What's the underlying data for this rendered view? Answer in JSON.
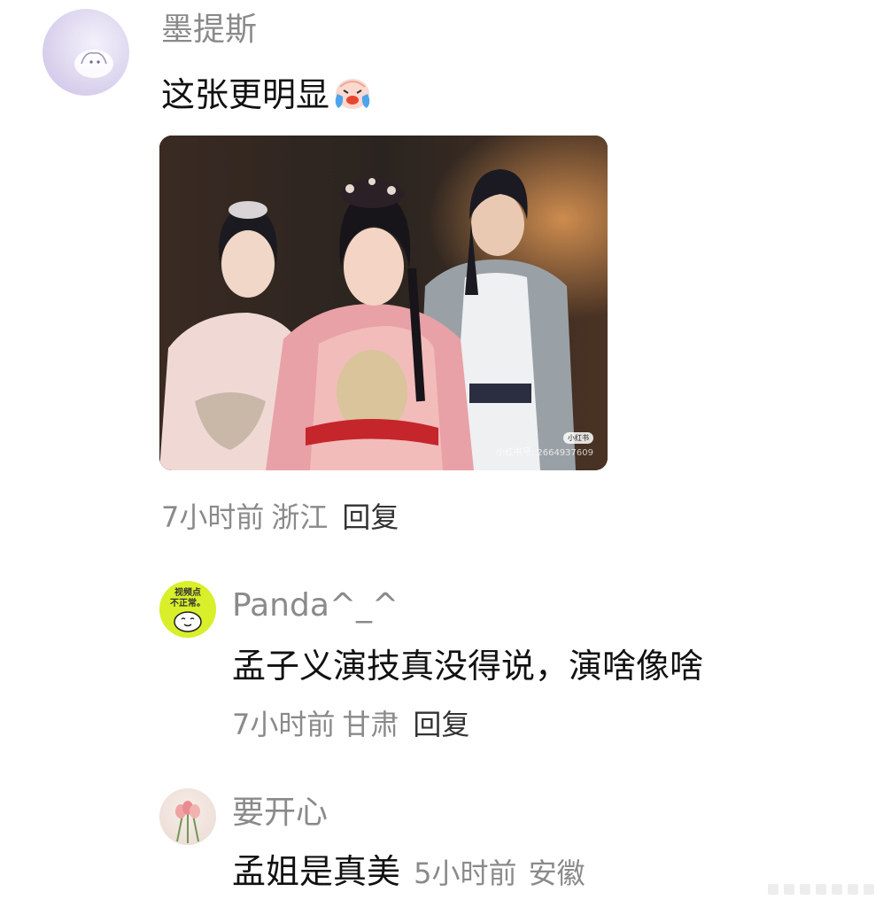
{
  "main_comment": {
    "username": "墨提斯",
    "text": "这张更明显",
    "emoji_icon": "crying-laughing-emoji-icon",
    "time": "7小时前",
    "location": "浙江",
    "reply_label": "回复",
    "image_watermark": "小红书号: 2664937609",
    "image_badge": "小红书"
  },
  "replies": [
    {
      "username": "Panda^_^",
      "avatar_text_line1": "视频点",
      "avatar_text_line2": "不正常。",
      "text": "孟子义演技真没得说，演啥像啥",
      "time": "7小时前",
      "location": "甘肃",
      "reply_label": "回复",
      "avatar_color": "#d8ef2a"
    },
    {
      "username": "要开心",
      "text": "孟姐是真美",
      "time": "5小时前",
      "location": "安徽"
    }
  ]
}
